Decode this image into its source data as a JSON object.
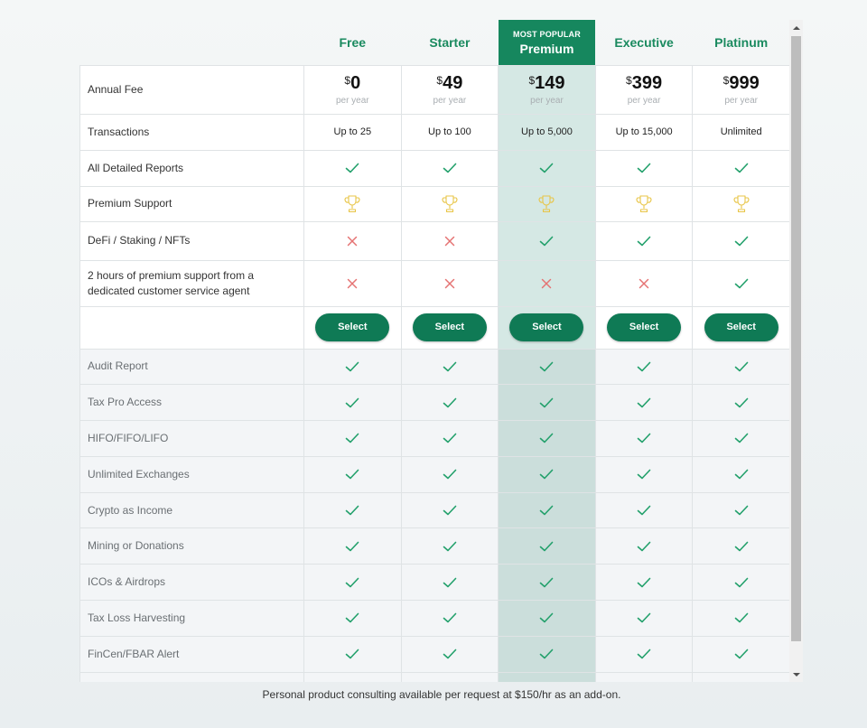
{
  "plans": [
    {
      "name": "Free",
      "currency": "$",
      "price": "0",
      "period": "per year",
      "transactions": "Up to 25",
      "popular": false
    },
    {
      "name": "Starter",
      "currency": "$",
      "price": "49",
      "period": "per year",
      "transactions": "Up to 100",
      "popular": false
    },
    {
      "name": "Premium",
      "currency": "$",
      "price": "149",
      "period": "per year",
      "transactions": "Up to 5,000",
      "popular": true,
      "popular_tag": "MOST POPULAR"
    },
    {
      "name": "Executive",
      "currency": "$",
      "price": "399",
      "period": "per year",
      "transactions": "Up to 15,000",
      "popular": false
    },
    {
      "name": "Platinum",
      "currency": "$",
      "price": "999",
      "period": "per year",
      "transactions": "Unlimited",
      "popular": false
    }
  ],
  "rows_top": {
    "annual_fee": "Annual Fee",
    "transactions": "Transactions"
  },
  "feature_rows": [
    {
      "label": "All Detailed Reports",
      "values": [
        "check",
        "check",
        "check",
        "check",
        "check"
      ]
    },
    {
      "label": "Premium Support",
      "values": [
        "trophy",
        "trophy",
        "trophy",
        "trophy",
        "trophy"
      ]
    },
    {
      "label": "DeFi / Staking / NFTs",
      "values": [
        "cross",
        "cross",
        "check",
        "check",
        "check"
      ]
    },
    {
      "label": "2 hours of premium support from a dedicated customer service agent",
      "values": [
        "cross",
        "cross",
        "cross",
        "cross",
        "check"
      ]
    }
  ],
  "select_label": "Select",
  "included_rows": [
    {
      "label": "Audit Report",
      "values": [
        "check",
        "check",
        "check",
        "check",
        "check"
      ]
    },
    {
      "label": "Tax Pro Access",
      "values": [
        "check",
        "check",
        "check",
        "check",
        "check"
      ]
    },
    {
      "label": "HIFO/FIFO/LIFO",
      "values": [
        "check",
        "check",
        "check",
        "check",
        "check"
      ]
    },
    {
      "label": "Unlimited Exchanges",
      "values": [
        "check",
        "check",
        "check",
        "check",
        "check"
      ]
    },
    {
      "label": "Crypto as Income",
      "values": [
        "check",
        "check",
        "check",
        "check",
        "check"
      ]
    },
    {
      "label": "Mining or Donations",
      "values": [
        "check",
        "check",
        "check",
        "check",
        "check"
      ]
    },
    {
      "label": "ICOs & Airdrops",
      "values": [
        "check",
        "check",
        "check",
        "check",
        "check"
      ]
    },
    {
      "label": "Tax Loss Harvesting",
      "values": [
        "check",
        "check",
        "check",
        "check",
        "check"
      ]
    },
    {
      "label": "FinCen/FBAR Alert",
      "values": [
        "check",
        "check",
        "check",
        "check",
        "check"
      ]
    },
    {
      "label": "",
      "values": [
        "",
        "",
        "",
        "",
        ""
      ]
    }
  ],
  "footnote": "Personal product consulting available per request at $150/hr as an add-on.",
  "colors": {
    "accent": "#0f7a55",
    "header_text": "#1a8a5f",
    "check": "#22a06b",
    "cross": "#e57373",
    "trophy": "#e8c547"
  },
  "icons": {
    "check": "check-icon",
    "cross": "cross-icon",
    "trophy": "trophy-icon"
  }
}
